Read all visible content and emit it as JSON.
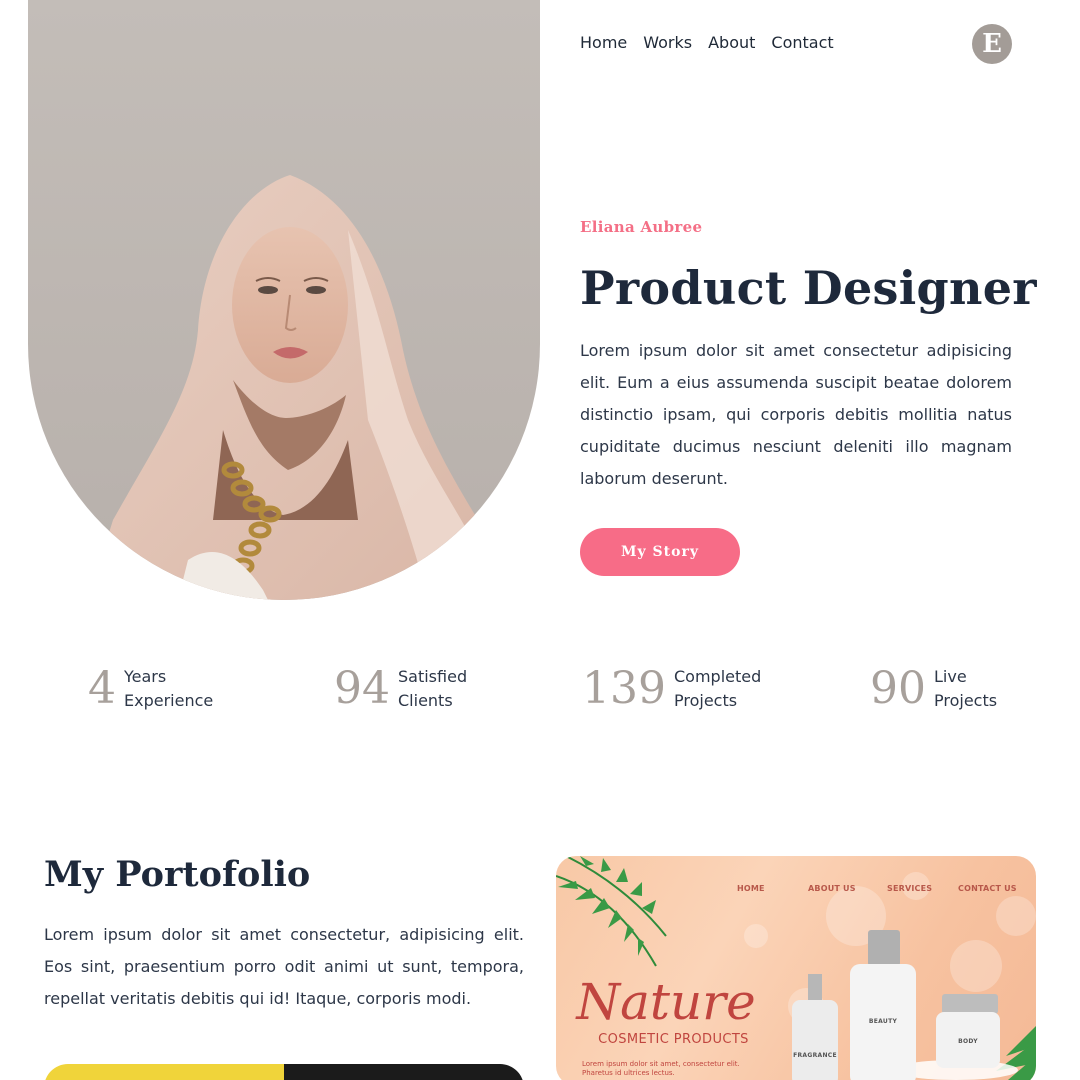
{
  "nav": {
    "items": [
      "Home",
      "Works",
      "About",
      "Contact"
    ],
    "logo_letter": "E"
  },
  "hero": {
    "name": "Eliana Aubree",
    "title": "Product Designer",
    "description": "Lorem ipsum dolor sit amet consectetur adipisicing elit. Eum a eius assumenda suscipit beatae dolorem distinctio ipsam, qui corporis debitis mollitia natus cupiditate ducimus nesciunt deleniti illo magnam laborum deserunt.",
    "button_label": "My Story"
  },
  "stats": [
    {
      "number": "4",
      "line1": "Years",
      "line2": "Experience"
    },
    {
      "number": "94",
      "line1": "Satisfied",
      "line2": "Clients"
    },
    {
      "number": "139",
      "line1": "Completed",
      "line2": "Projects"
    },
    {
      "number": "90",
      "line1": "Live",
      "line2": "Projects"
    }
  ],
  "portfolio": {
    "title": "My Portofolio",
    "description": "Lorem ipsum dolor sit amet consectetur, adipisicing elit. Eos sint, praesentium porro odit animi ut sunt, tempora, repellat veritatis debitis qui id! Itaque, corporis modi.",
    "card": {
      "nav": [
        "HOME",
        "ABOUT US",
        "SERVICES",
        "CONTACT US"
      ],
      "brand": "Nature",
      "subtitle": "COSMETIC PRODUCTS",
      "small_text": "Lorem ipsum dolor sit amet, consectetur elit. Pharetus id ultrices lectus.",
      "labels": [
        "FRAGRANCE",
        "BEAUTY",
        "BODY"
      ]
    }
  },
  "colors": {
    "accent": "#f76c87",
    "heading": "#1e293b",
    "muted_number": "#a7a09b",
    "logo_bg": "#a39c97",
    "tab_yellow": "#f0d43a",
    "tab_dark": "#1b1b1b"
  }
}
